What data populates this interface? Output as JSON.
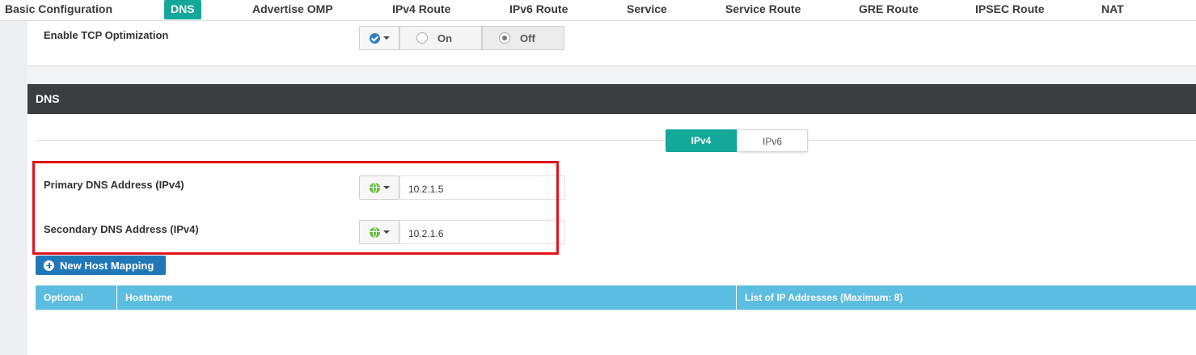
{
  "nav": {
    "tabs": [
      {
        "label": "Basic Configuration"
      },
      {
        "label": "DNS"
      },
      {
        "label": "Advertise OMP"
      },
      {
        "label": "IPv4 Route"
      },
      {
        "label": "IPv6 Route"
      },
      {
        "label": "Service"
      },
      {
        "label": "Service Route"
      },
      {
        "label": "GRE Route"
      },
      {
        "label": "IPSEC Route"
      },
      {
        "label": "NAT"
      }
    ],
    "active_tab": "DNS"
  },
  "tcp": {
    "label": "Enable TCP Optimization",
    "scope_icon": "check-circle-icon",
    "options": [
      "On",
      "Off"
    ],
    "selected": "Off"
  },
  "dns": {
    "header": "DNS",
    "ip_toggle": [
      "IPv4",
      "IPv6"
    ],
    "active_ip": "IPv4",
    "primary_label": "Primary DNS Address (IPv4)",
    "primary_value": "10.2.1.5",
    "secondary_label": "Secondary DNS Address (IPv4)",
    "secondary_value": "10.2.1.6",
    "scope_icon": "globe-icon",
    "new_host_button": "New Host Mapping",
    "table_headers": [
      "Optional",
      "Hostname",
      "List of IP Addresses (Maximum: 8)"
    ]
  },
  "colors": {
    "accent_teal": "#14a89a",
    "header_dark": "#3b3d40",
    "button_blue": "#2178b8",
    "table_head": "#5bbde0",
    "highlight_red": "#e0141c"
  }
}
